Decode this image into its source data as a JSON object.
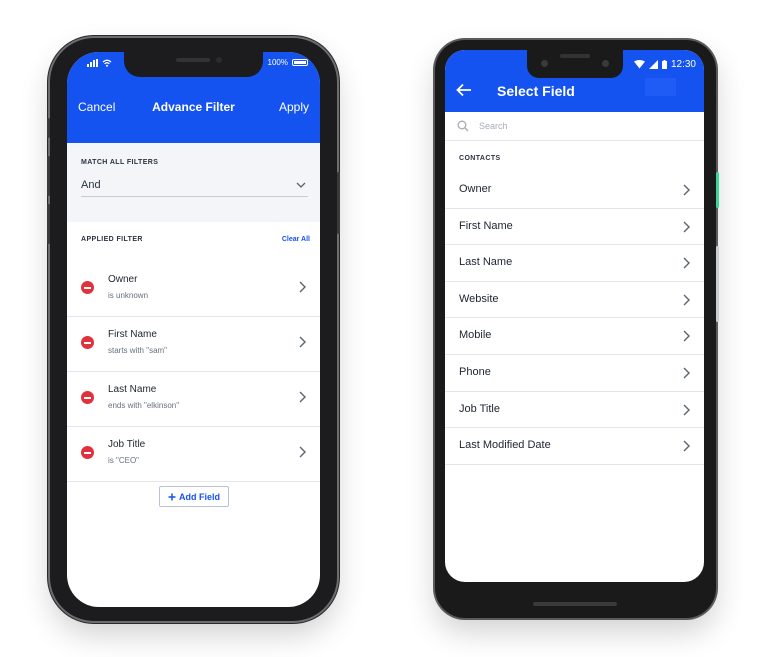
{
  "ios": {
    "status": {
      "battery": "100%"
    },
    "nav": {
      "cancel": "Cancel",
      "title": "Advance Filter",
      "apply": "Apply"
    },
    "match": {
      "label": "MATCH ALL FILTERS",
      "value": "And"
    },
    "applied": {
      "label": "APPLIED FILTER",
      "clear": "Clear All"
    },
    "filters": [
      {
        "name": "Owner",
        "condition": "is unknown"
      },
      {
        "name": "First Name",
        "condition": "starts with \"sam\""
      },
      {
        "name": "Last Name",
        "condition": "ends with \"elkinson\""
      },
      {
        "name": "Job Title",
        "condition": "is \"CEO\""
      }
    ],
    "add_field": "Add Field"
  },
  "android": {
    "status": {
      "time": "12:30"
    },
    "title": "Select Field",
    "search_placeholder": "Search",
    "section": "CONTACTS",
    "fields": [
      "Owner",
      "First Name",
      "Last Name",
      "Website",
      "Mobile",
      "Phone",
      "Job Title",
      "Last Modified Date"
    ]
  },
  "colors": {
    "accent": "#1453f0",
    "remove": "#e0323c",
    "android_edge": "#3dd598"
  }
}
